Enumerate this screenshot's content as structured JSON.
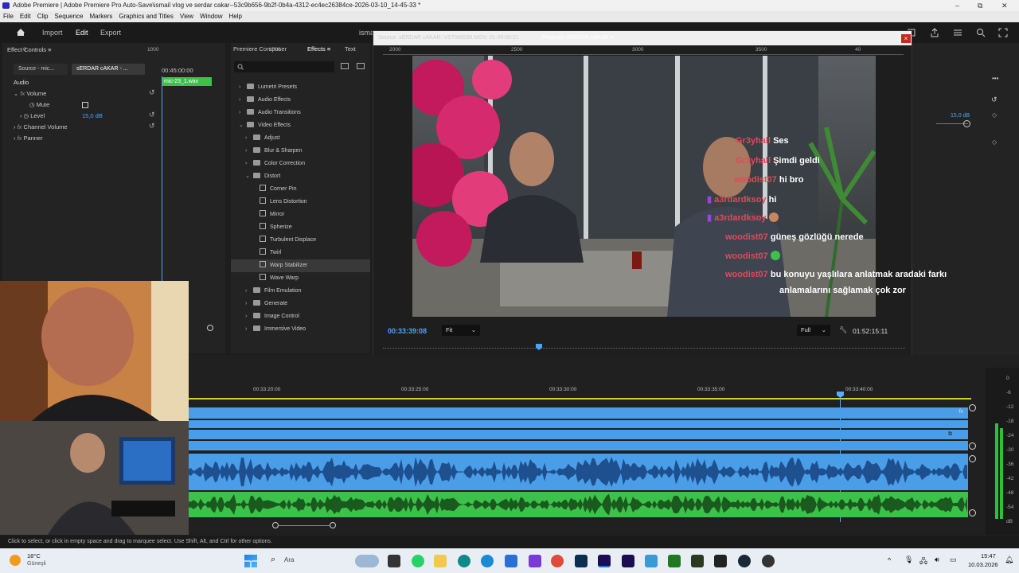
{
  "window": {
    "title": "Adobe Premiere Pro Auto-Save\\ismail vlog ve serdar cakar--53c9b656-9b2f-0b4a-4312-ec4ec26384ce-2026-03-10_14-45-33 *",
    "app": "Adobe Premiere",
    "controls": [
      "–",
      "⧉",
      "✕"
    ]
  },
  "menu": [
    "File",
    "Edit",
    "Clip",
    "Sequence",
    "Markers",
    "Graphics and Titles",
    "View",
    "Window",
    "Help"
  ],
  "workspace": {
    "tabs": [
      "Import",
      "Edit",
      "Export"
    ],
    "active": "Edit",
    "project": "isma"
  },
  "effect_controls": {
    "title": "Effect Controls",
    "tab_source": "Source - mic...",
    "tab_seq": "sERDAR cAKAR - ...",
    "timecode": "00:45:00:00",
    "clip": "mic-23_1.wav",
    "section": "Audio",
    "volume": "Volume",
    "mute": "Mute",
    "level": "Level",
    "level_value": "15,0 dB",
    "channel_volume": "Channel Volume",
    "panner": "Panner"
  },
  "effects_panel": {
    "tab_composer": "Premiere Composer",
    "tab_effects": "Effects",
    "tab_text": "Text",
    "items": [
      "Lumetri Presets",
      "Audio Effects",
      "Audio Transitions",
      "Video Effects",
      "Adjust",
      "Blur & Sharpen",
      "Color Correction",
      "Distort",
      "Corner Pin",
      "Lens Distortion",
      "Mirror",
      "Spherize",
      "Turbulent Displace",
      "Twirl",
      "Warp Stabilizer",
      "Wave Warp",
      "Film Emulation",
      "Generate",
      "Image Control",
      "Immersive Video"
    ]
  },
  "monitor": {
    "source": "Source: sERDAR cAKAR: VSTW8599.MOV: 01:49:00:21",
    "program": "Program: sERDAR cAKAR",
    "ruler": [
      "0",
      "1000",
      "1500",
      "2000",
      "2500",
      "3000",
      "3500",
      "40"
    ],
    "timecode": "00:33:39:08",
    "fit": "Fit",
    "full": "Full",
    "duration": "01:52:15:11"
  },
  "chat": [
    {
      "user": "Gr3yhall",
      "msg": "Ses"
    },
    {
      "user": "Gr3yhall",
      "msg": "Şimdi geldi"
    },
    {
      "user": "woodist07",
      "msg": "hi bro"
    },
    {
      "user": "a3rdardksoy",
      "msg": "hi"
    },
    {
      "user": "a3rdardksoy",
      "msg": ""
    },
    {
      "user": "woodist07",
      "msg": "güneş gözlüğü nerede"
    },
    {
      "user": "woodist07",
      "msg": ""
    },
    {
      "user": "woodist07",
      "msg": "bu konuyu yaşlılara anlatmak aradaki farkı"
    },
    {
      "user": "",
      "msg": "anlamalarını sağlamak çok zor"
    }
  ],
  "timeline": {
    "ticks": [
      "00:33:20:00",
      "00:33:25:00",
      "00:33:30:00",
      "00:33:35:00",
      "00:33:40:00"
    ]
  },
  "meter": {
    "labels": [
      "0",
      "-6",
      "-12",
      "-18",
      "-24",
      "-30",
      "-36",
      "-42",
      "-48",
      "-54",
      "dB"
    ]
  },
  "right_panel": {
    "level": "15,0 dB"
  },
  "status": "Click to select, or click in empty space and drag to marquee select. Use Shift, Alt, and Ctrl for other options.",
  "taskbar": {
    "weather_temp": "18°C",
    "weather_label": "Güneşli",
    "search": "Ara",
    "time": "15:47",
    "date": "10.03.2026"
  },
  "colors": {
    "accent": "#4aa3ff",
    "track_blue": "#4a9ee8",
    "track_green": "#3cc14a",
    "chat_user": "#e04a5a"
  }
}
